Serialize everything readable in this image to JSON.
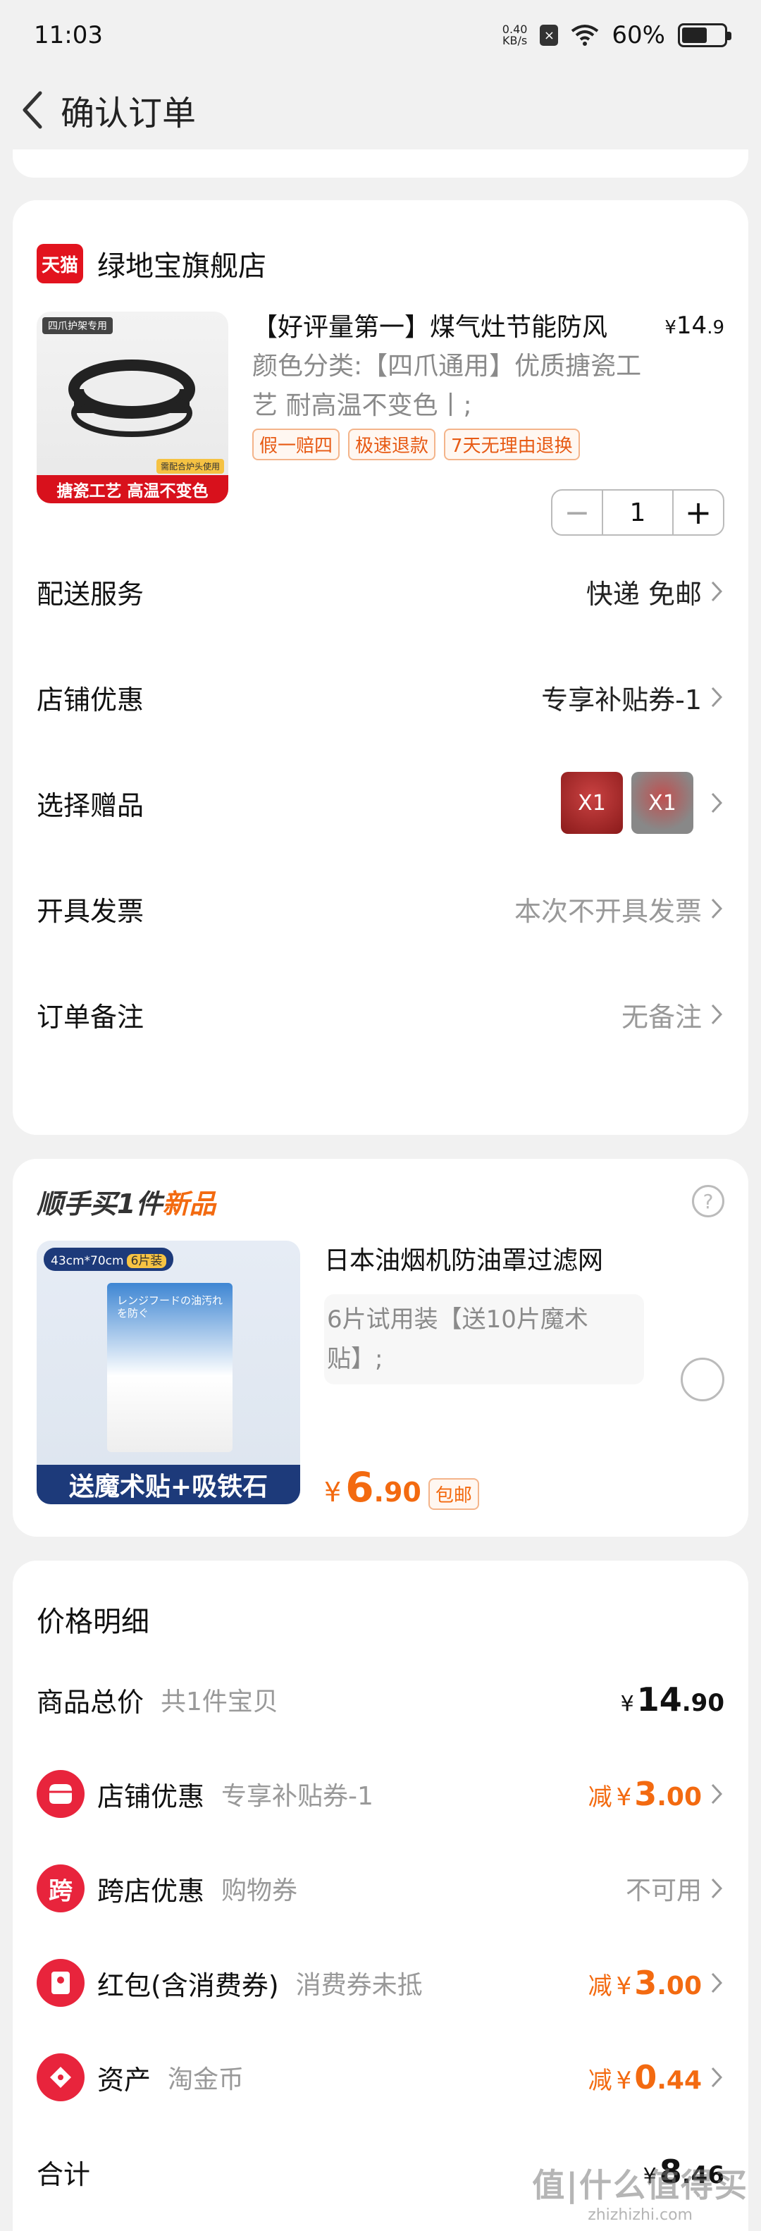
{
  "status_bar": {
    "time": "11:03",
    "net_speed_value": "0.40",
    "net_speed_unit": "KB/s",
    "battery": "60%",
    "battery_fraction": 0.6
  },
  "nav": {
    "title": "确认订单",
    "back_icon": "chevron-left-icon"
  },
  "store": {
    "platform_badge": "天猫",
    "name": "绿地宝旗舰店",
    "product": {
      "image_tag": "四爪护架专用",
      "image_banner": "搪瓷工艺 高温不变色",
      "image_corner": "需配合炉头使用",
      "title": "【好评量第一】煤气灶节能防风",
      "price_currency": "¥",
      "price_int": "14",
      "price_dec": ".9",
      "sku": "颜色分类:【四爪通用】优质搪瓷工艺 耐高温不变色丨;",
      "tags": [
        "假一赔四",
        "极速退款",
        "7天无理由退换"
      ],
      "quantity": "1",
      "minus": "−",
      "plus": "+"
    },
    "options": [
      {
        "label": "配送服务",
        "value": "快递 免邮",
        "style": "dark"
      },
      {
        "label": "店铺优惠",
        "value": "专享补贴券-1",
        "style": "dark"
      },
      {
        "label": "选择赠品",
        "gifts": [
          "X1",
          "X1"
        ]
      },
      {
        "label": "开具发票",
        "value": "本次不开具发票",
        "style": "grey"
      },
      {
        "label": "订单备注",
        "value": "无备注",
        "style": "grey"
      }
    ]
  },
  "addon": {
    "title_prefix": "顺手买1件",
    "title_highlight": "新品",
    "help_icon": "question-circle-icon",
    "image_size_tag": "43cm*70cm",
    "image_count_tag": "6片装",
    "image_box_text": "レンジフードの油汚れを防ぐ",
    "image_banner": "送魔术贴+吸铁石",
    "name": "日本油烟机防油罩过滤网",
    "desc": "6片试用装【送10片魔术贴】;",
    "price_currency": "¥",
    "price_int": "6",
    "price_dec": ".90",
    "shipping": "包邮"
  },
  "price_details": {
    "title": "价格明细",
    "rows": [
      {
        "label": "商品总价",
        "sub": "共1件宝贝",
        "type": "amount",
        "cur": "¥",
        "int": "14",
        "dec": ".90"
      },
      {
        "icon": "store-coupon-icon",
        "label": "店铺优惠",
        "sub": "专享补贴券-1",
        "type": "discount",
        "pre": "减",
        "cur": "¥",
        "int": "3",
        "dec": ".00"
      },
      {
        "icon": "cross-store-icon",
        "icon_text": "跨",
        "label": "跨店优惠",
        "sub": "购物券",
        "type": "na",
        "value": "不可用"
      },
      {
        "icon": "red-packet-icon",
        "label": "红包(含消费券)",
        "sub": "消费券未抵",
        "type": "discount",
        "pre": "减",
        "cur": "¥",
        "int": "3",
        "dec": ".00"
      },
      {
        "icon": "asset-tag-icon",
        "label": "资产",
        "sub": "淘金币",
        "type": "discount",
        "pre": "减",
        "cur": "¥",
        "int": "0",
        "dec": ".44"
      }
    ],
    "total_label": "合计",
    "total_cur": "¥",
    "total_int": "8",
    "total_dec": ".46"
  },
  "watermark": {
    "big": "值|什么值得买",
    "small": "zhizhizhi.com"
  },
  "colors": {
    "accent": "#f36a10",
    "tmall_red": "#e2131e",
    "icon_red": "#e8243c"
  }
}
